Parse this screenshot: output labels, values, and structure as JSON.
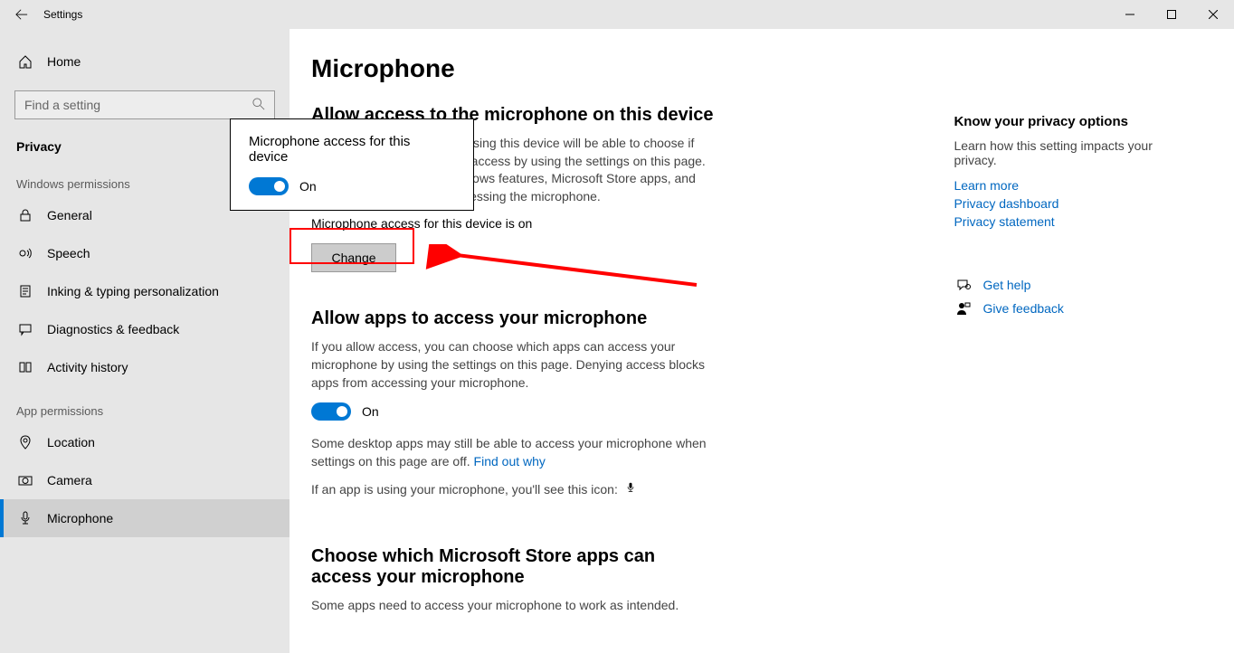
{
  "window": {
    "title": "Settings"
  },
  "sidebar": {
    "home": "Home",
    "search_placeholder": "Find a setting",
    "category": "Privacy",
    "section_windows": "Windows permissions",
    "section_app": "App permissions",
    "items_win": [
      {
        "label": "General",
        "icon": "lock"
      },
      {
        "label": "Speech",
        "icon": "speech"
      },
      {
        "label": "Inking & typing personalization",
        "icon": "inking"
      },
      {
        "label": "Diagnostics & feedback",
        "icon": "feedback"
      },
      {
        "label": "Activity history",
        "icon": "history"
      }
    ],
    "items_app": [
      {
        "label": "Location",
        "icon": "location"
      },
      {
        "label": "Camera",
        "icon": "camera"
      },
      {
        "label": "Microphone",
        "icon": "microphone"
      }
    ]
  },
  "main": {
    "title": "Microphone",
    "sec1_title": "Allow access to the microphone on this device",
    "sec1_body": "If you allow access, people using this device will be able to choose if their apps have microphone access by using the settings on this page. Denying access blocks Windows features, Microsoft Store apps, and most desktop apps from accessing the microphone.",
    "sec1_status": "Microphone access for this device is on",
    "change_label": "Change",
    "sec2_title": "Allow apps to access your microphone",
    "sec2_body": "If you allow access, you can choose which apps can access your microphone by using the settings on this page. Denying access blocks apps from accessing your microphone.",
    "toggle2_label": "On",
    "sec2_note_a": "Some desktop apps may still be able to access your microphone when settings on this page are off. ",
    "sec2_note_link": "Find out why",
    "sec2_icon_line": "If an app is using your microphone, you'll see this icon:",
    "sec3_title": "Choose which Microsoft Store apps can access your microphone",
    "sec3_body": "Some apps need to access your microphone to work as intended."
  },
  "right": {
    "heading": "Know your privacy options",
    "body": "Learn how this setting impacts your privacy.",
    "links": [
      "Learn more",
      "Privacy dashboard",
      "Privacy statement"
    ],
    "help": "Get help",
    "feedback": "Give feedback"
  },
  "flyout": {
    "title": "Microphone access for this device",
    "toggle_label": "On"
  }
}
